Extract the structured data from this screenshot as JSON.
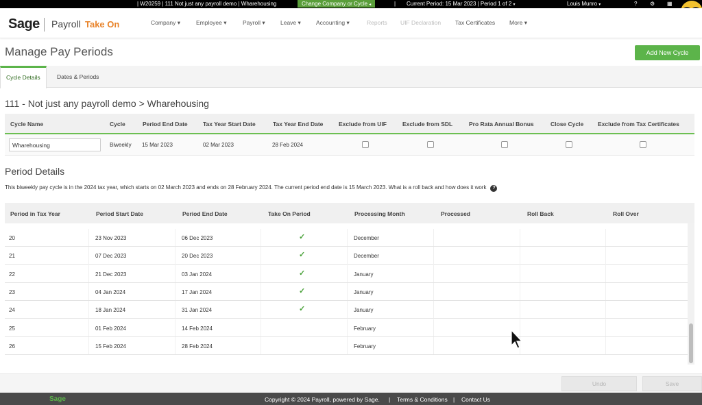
{
  "topbar": {
    "company": "| W20259 | 111 Not just any payroll demo | Wharehousing",
    "change_label": "Change Company or Cycle",
    "current_period": "Current Period: 15 Mar 2023 | Period 1 of 2",
    "user": "Louis Munro",
    "help": "?"
  },
  "header": {
    "logo": "Sage",
    "product": "Payroll",
    "module": "Take On",
    "nav": [
      {
        "label": "Company",
        "caret": true
      },
      {
        "label": "Employee",
        "caret": true
      },
      {
        "label": "Payroll",
        "caret": true
      },
      {
        "label": "Leave",
        "caret": true
      },
      {
        "label": "Accounting",
        "caret": true
      },
      {
        "label": "Reports",
        "caret": false,
        "disabled": true
      },
      {
        "label": "UIF Declaration",
        "caret": false,
        "disabled": true
      },
      {
        "label": "Tax Certificates",
        "caret": false
      },
      {
        "label": "More",
        "caret": true
      }
    ]
  },
  "page": {
    "title": "Manage Pay Periods",
    "add_button": "Add New Cycle"
  },
  "tabs": [
    {
      "label": "Cycle Details",
      "active": true
    },
    {
      "label": "Dates & Periods",
      "active": false
    }
  ],
  "cycle_section": {
    "title": "111 - Not just any payroll demo > Wharehousing",
    "headers": [
      "Cycle Name",
      "Cycle",
      "Period End Date",
      "Tax Year Start Date",
      "Tax Year End Date",
      "Exclude from UIF",
      "Exclude from SDL",
      "Pro Rata Annual Bonus",
      "Close Cycle",
      "Exclude from Tax Certificates"
    ],
    "row": {
      "name": "Wharehousing",
      "cycle": "Biweekly",
      "period_end": "15 Mar 2023",
      "tax_start": "02 Mar 2023",
      "tax_end": "28 Feb 2024"
    }
  },
  "period_section": {
    "title": "Period Details",
    "info": "This biweekly pay cycle is in the 2024 tax year, which starts on 02 March 2023 and ends on 28 February 2024. The current period end date is 15 March 2023. What is a roll back and how does it work",
    "headers": [
      "Period in Tax Year",
      "Period Start Date",
      "Period End Date",
      "Take On Period",
      "Processing Month",
      "Processed",
      "Roll Back",
      "Roll Over"
    ],
    "rows": [
      {
        "period": "20",
        "start": "23 Nov 2023",
        "end": "06 Dec 2023",
        "take_on": true,
        "month": "December"
      },
      {
        "period": "21",
        "start": "07 Dec 2023",
        "end": "20 Dec 2023",
        "take_on": true,
        "month": "December"
      },
      {
        "period": "22",
        "start": "21 Dec 2023",
        "end": "03 Jan 2024",
        "take_on": true,
        "month": "January"
      },
      {
        "period": "23",
        "start": "04 Jan 2024",
        "end": "17 Jan 2024",
        "take_on": true,
        "month": "January"
      },
      {
        "period": "24",
        "start": "18 Jan 2024",
        "end": "31 Jan 2024",
        "take_on": true,
        "month": "January"
      },
      {
        "period": "25",
        "start": "01 Feb 2024",
        "end": "14 Feb 2024",
        "take_on": false,
        "month": "February"
      },
      {
        "period": "26",
        "start": "15 Feb 2024",
        "end": "28 Feb 2024",
        "take_on": false,
        "month": "February"
      }
    ]
  },
  "actions": {
    "undo": "Undo",
    "save": "Save"
  },
  "footer": {
    "logo": "Sage",
    "copyright": "Copyright © 2024 Payroll, powered by Sage.",
    "sep": "|",
    "terms": "Terms & Conditions",
    "contact": "Contact Us"
  },
  "icons": {
    "check": "check-icon",
    "help": "question-circle-icon",
    "caret": "caret-down-icon"
  },
  "colors": {
    "accent": "#5cb44a",
    "takeon": "#e8832a",
    "topbar": "#000000",
    "footer": "#4a4a4a"
  }
}
